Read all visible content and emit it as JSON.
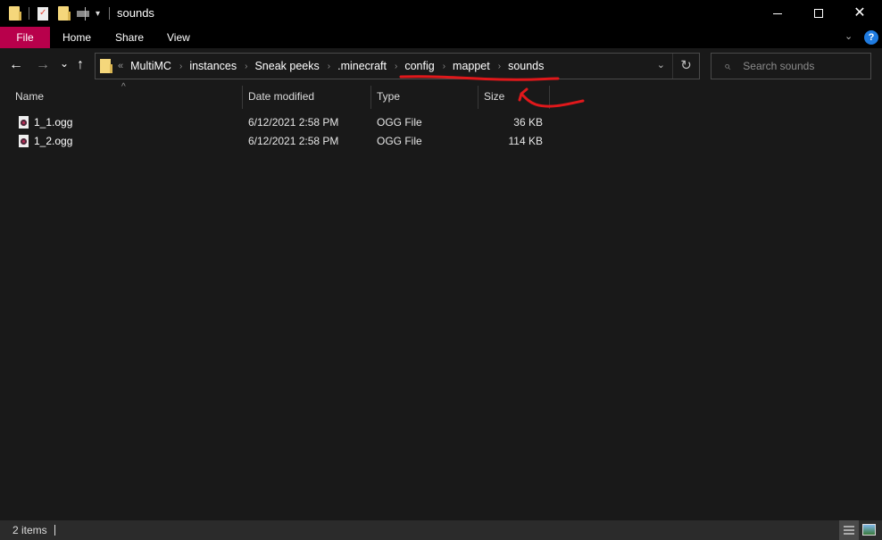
{
  "window": {
    "title": "sounds",
    "controls": {
      "minimize": "minimize",
      "maximize": "maximize",
      "close": "✕"
    }
  },
  "ribbon": {
    "tabs": [
      {
        "label": "File",
        "active": true
      },
      {
        "label": "Home"
      },
      {
        "label": "Share"
      },
      {
        "label": "View"
      }
    ],
    "accent_color": "#b8004b",
    "help_label": "?"
  },
  "nav": {
    "back": "←",
    "forward": "→",
    "recent": "⌄",
    "up": "↑",
    "overflow": "«",
    "breadcrumbs": [
      "MultiMC",
      "instances",
      "Sneak peeks",
      ".minecraft",
      "config",
      "mappet",
      "sounds"
    ],
    "crumb_separator": "›",
    "dropdown": "⌄",
    "refresh": "↻"
  },
  "search": {
    "placeholder": "Search sounds",
    "icon": "⌕"
  },
  "columns": [
    {
      "label": "Name"
    },
    {
      "label": "Date modified"
    },
    {
      "label": "Type"
    },
    {
      "label": "Size"
    }
  ],
  "sort_indicator": "^",
  "files": [
    {
      "name": "1_1.ogg",
      "date": "6/12/2021 2:58 PM",
      "type": "OGG File",
      "size": "36 KB"
    },
    {
      "name": "1_2.ogg",
      "date": "6/12/2021 2:58 PM",
      "type": "OGG File",
      "size": "114 KB"
    }
  ],
  "annotation": {
    "color": "#e0181b"
  },
  "status": {
    "item_count": "2 items"
  }
}
